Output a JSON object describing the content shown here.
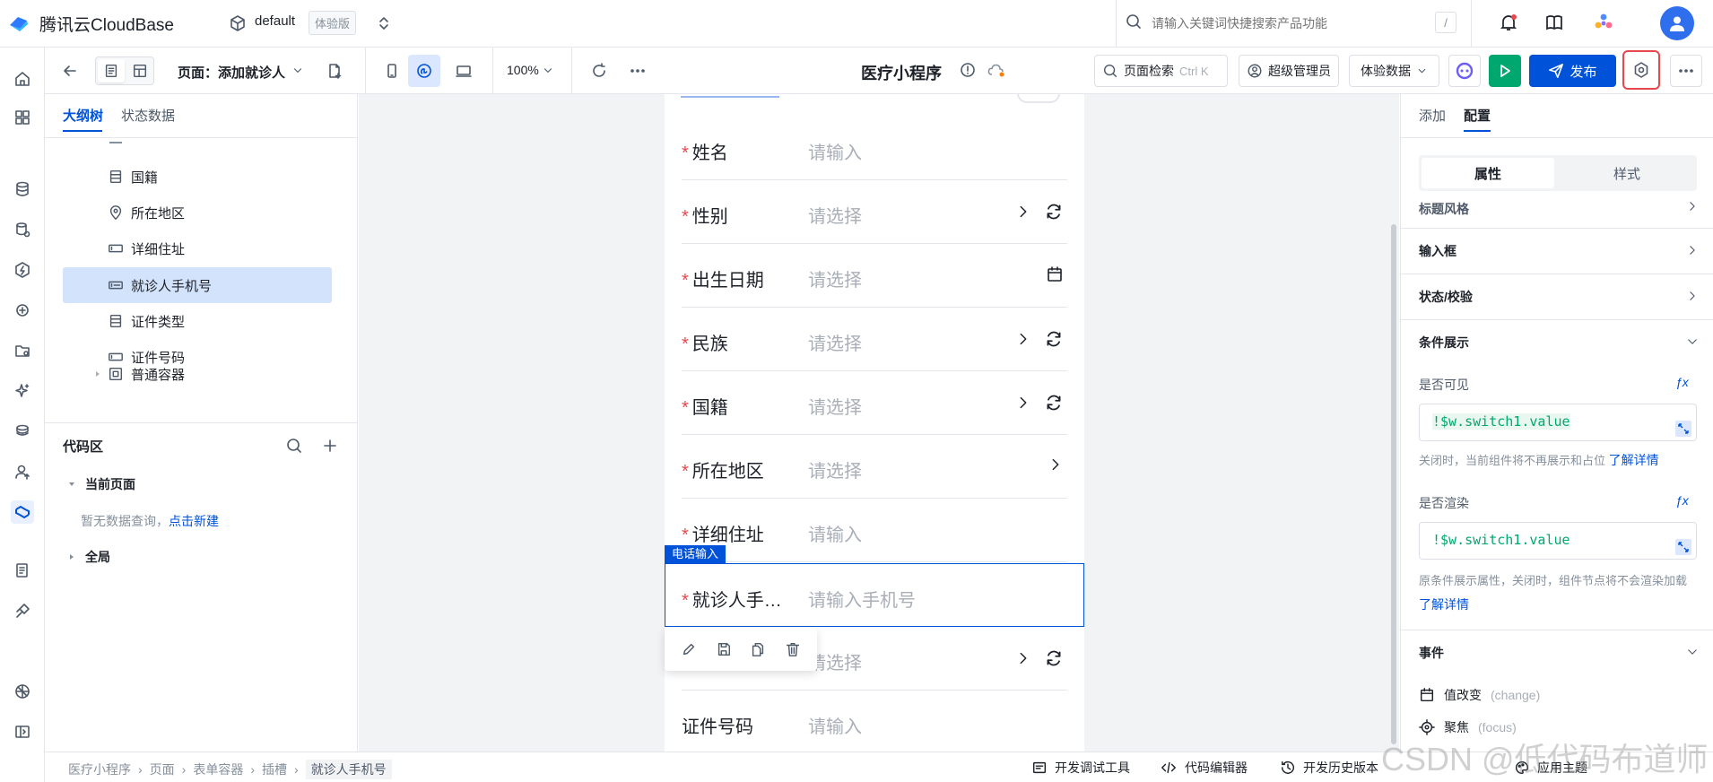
{
  "header": {
    "brand": "腾讯云CloudBase",
    "env_name": "default",
    "env_badge": "体验版",
    "search_placeholder": "请输入关键词快捷搜索产品功能",
    "search_shortcut": "/"
  },
  "toolbar": {
    "page_label": "页面：添加就诊人",
    "zoom": "100%",
    "app_title": "医疗小程序",
    "page_search": "页面检索",
    "page_search_shortcut": "Ctrl K",
    "role": "超级管理员",
    "data_mode": "体验数据",
    "publish": "发布"
  },
  "left_panel": {
    "tabs": [
      "大纲树",
      "状态数据"
    ],
    "tree": [
      {
        "label": "国籍",
        "icon": "list-icon"
      },
      {
        "label": "所在地区",
        "icon": "location-icon"
      },
      {
        "label": "详细住址",
        "icon": "input-icon"
      },
      {
        "label": "就诊人手机号",
        "icon": "phone-input-icon",
        "selected": true
      },
      {
        "label": "证件类型",
        "icon": "list-icon"
      },
      {
        "label": "证件号码",
        "icon": "input-icon"
      },
      {
        "label": "普通容器",
        "icon": "container-icon"
      }
    ],
    "code_area": {
      "title": "代码区",
      "current_page": "当前页面",
      "empty_text": "暂无数据查询，",
      "create_link": "点击新建",
      "global": "全局"
    }
  },
  "canvas": {
    "fields": [
      {
        "label": "姓名",
        "placeholder": "请输入",
        "required": true,
        "control": "none"
      },
      {
        "label": "性别",
        "placeholder": "请选择",
        "required": true,
        "control": "select"
      },
      {
        "label": "出生日期",
        "placeholder": "请选择",
        "required": true,
        "control": "date"
      },
      {
        "label": "民族",
        "placeholder": "请选择",
        "required": true,
        "control": "select"
      },
      {
        "label": "国籍",
        "placeholder": "请选择",
        "required": true,
        "control": "select"
      },
      {
        "label": "所在地区",
        "placeholder": "请选择",
        "required": true,
        "control": "chevron"
      },
      {
        "label": "详细住址",
        "placeholder": "请输入",
        "required": true,
        "control": "none"
      }
    ],
    "selected_field": {
      "tag": "电话输入",
      "label": "就诊人手…",
      "placeholder": "请输入手机号"
    },
    "after_fields": [
      {
        "label": "",
        "placeholder": "请选择",
        "control": "select"
      },
      {
        "label": "证件号码",
        "placeholder": "请输入",
        "control": "none"
      }
    ]
  },
  "right_panel": {
    "tabs": [
      "添加",
      "配置"
    ],
    "segments": [
      "属性",
      "样式"
    ],
    "sections": {
      "title_style": "标题风格",
      "input_box": "输入框",
      "state_validation": "状态/校验",
      "conditional": "条件展示",
      "visible_label": "是否可见",
      "visible_expr": "!$w.switch1.value",
      "visible_hint": "关闭时，当前组件将不再展示和占位",
      "learn_more": "了解详情",
      "render_label": "是否渲染",
      "render_expr": "!$w.switch1.value",
      "render_hint": "原条件展示属性，关闭时，组件节点将不会渲染加载",
      "events": "事件",
      "event_change": "值改变",
      "event_change_en": "(change)",
      "event_focus": "聚焦",
      "event_focus_en": "(focus)",
      "fx": "ƒx"
    }
  },
  "bottom_bar": {
    "breadcrumb": [
      "医疗小程序",
      "页面",
      "表单容器",
      "插槽",
      "就诊人手机号"
    ],
    "dev_tools": "开发调试工具",
    "code_editor": "代码编辑器",
    "history": "开发历史版本",
    "theme": "应用主题"
  },
  "watermark": "CSDN @低代码布道师"
}
